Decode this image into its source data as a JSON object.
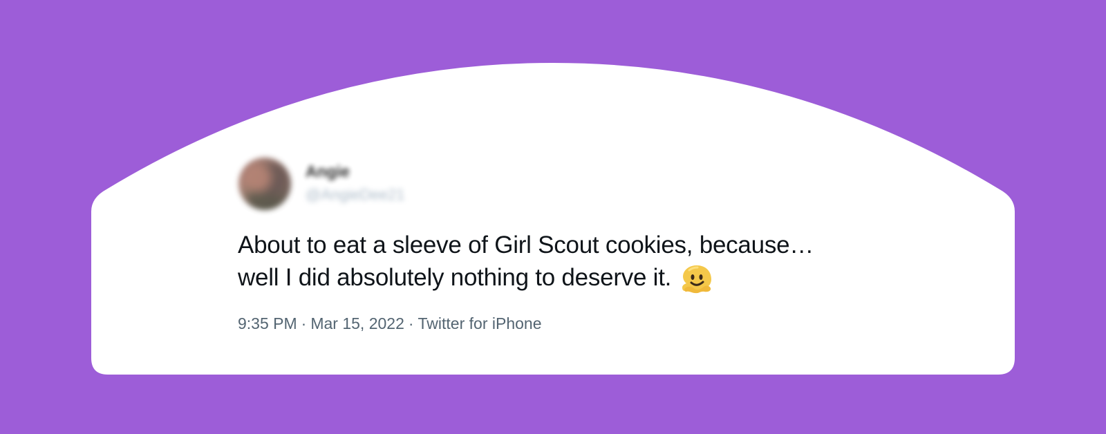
{
  "colors": {
    "background": "#9d5dd8",
    "card": "#ffffff",
    "text": "#0f1419",
    "muted_text": "#536471"
  },
  "tweet": {
    "author": {
      "display_name": "Angie",
      "handle": "@AngieDee21"
    },
    "text": {
      "line_1": "About to eat a sleeve of Girl Scout cookies, because…",
      "line_2": "well I did absolutely nothing to deserve it."
    },
    "emoji_icon": "melting-face-emoji",
    "timestamp": {
      "time": "9:35 PM",
      "separator_1": "·",
      "date": "Mar 15, 2022",
      "separator_2": "·",
      "source": "Twitter for iPhone"
    }
  }
}
